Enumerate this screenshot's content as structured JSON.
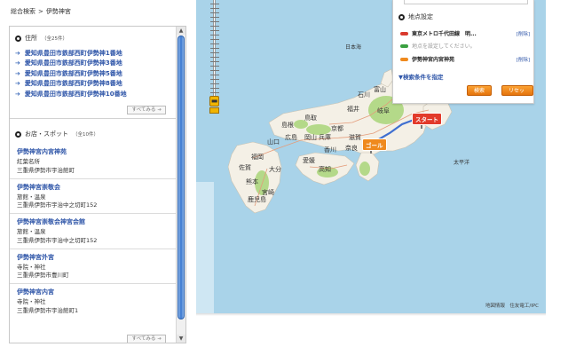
{
  "breadcrumb": {
    "home": "総合検索",
    "sep": ">",
    "current": "伊勢神宮"
  },
  "address_section": {
    "title": "住所",
    "count": "（全25件）",
    "items": [
      "愛知県豊田市鉄部西町伊勢神1番地",
      "愛知県豊田市鉄部西町伊勢神3番地",
      "愛知県豊田市鉄部西町伊勢神5番地",
      "愛知県豊田市鉄部西町伊勢神8番地",
      "愛知県豊田市鉄部西町伊勢神10番地"
    ],
    "more_label": "すべてみる"
  },
  "shops_section": {
    "title": "お店・スポット",
    "count": "（全10件）",
    "items": [
      {
        "name": "伊勢神宮内宮神苑",
        "category": "紅葉名所",
        "address": "三重県伊勢市宇治館町"
      },
      {
        "name": "伊勢神宮崇敬会",
        "category": "旅館・温泉",
        "address": "三重県伊勢市宇治中之切町152"
      },
      {
        "name": "伊勢神宮崇敬会神宮会館",
        "category": "旅館・温泉",
        "address": "三重県伊勢市宇治中之切町152"
      },
      {
        "name": "伊勢神宮外宮",
        "category": "寺院・神社",
        "address": "三重県伊勢市豊川町"
      },
      {
        "name": "伊勢神宮内宮",
        "category": "寺院・神社",
        "address": "三重県伊勢市宇治館町1"
      }
    ],
    "more_label": "すべてみる"
  },
  "map": {
    "sea_japan": "日本海",
    "pacific": "太平洋",
    "credit": "地図情報　住友電工/IPC",
    "labels": {
      "ishikawa": "石川",
      "toyama": "富山",
      "fukui": "福井",
      "gifu": "岐阜",
      "tottori": "鳥取",
      "shimane": "島根",
      "kyoto": "京都",
      "hyogo": "兵庫",
      "okayama": "岡山",
      "hiroshima": "広島",
      "yamaguchi": "山口",
      "kagawa": "香川",
      "ehime": "愛媛",
      "kochi": "高知",
      "shiga": "滋賀",
      "nara": "奈良",
      "fukuoka": "福岡",
      "oita": "大分",
      "saga": "佐賀",
      "kumamoto": "熊本",
      "miyazaki": "宮崎",
      "kagoshima": "鹿児島"
    },
    "start_label": "スタート",
    "goal_label": "ゴール"
  },
  "route_panel": {
    "title": "地点設定",
    "rows": [
      {
        "text": "東京メトロ千代田線　明...",
        "edit": "[削除]",
        "color": "#d93a2e",
        "placeholder": false
      },
      {
        "text": "地点を設定してください。",
        "edit": "",
        "color": "#3aa040",
        "placeholder": true
      },
      {
        "text": "伊勢神宮内宮神苑",
        "edit": "[削除]",
        "color": "#ef8a1e",
        "placeholder": false
      }
    ],
    "conditions_link": "▼検索条件を指定",
    "search_button": "検索",
    "reset_button": "リセット"
  },
  "colors": {
    "sea": "#a9d3e9",
    "land": "#f4f0e6",
    "route": "#3f6fd0",
    "accent_orange": "#ef8a1e"
  }
}
